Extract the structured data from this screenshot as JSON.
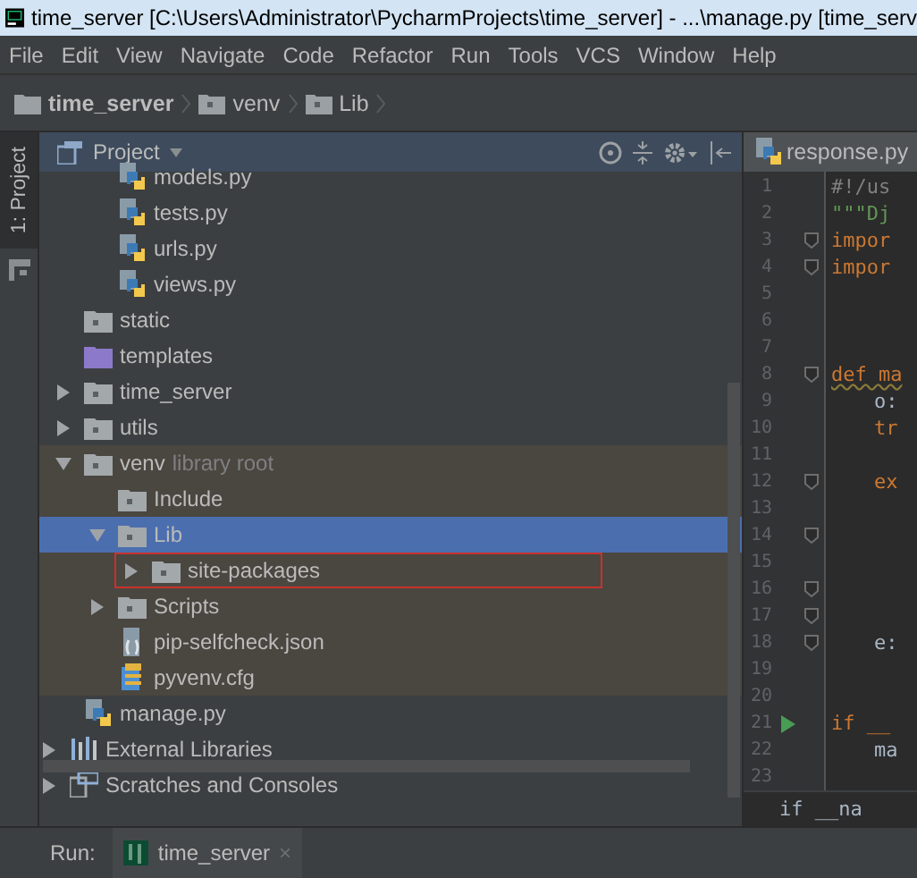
{
  "window": {
    "title": "time_server [C:\\Users\\Administrator\\PycharmProjects\\time_server] - ...\\manage.py [time_serv"
  },
  "menu": [
    "File",
    "Edit",
    "View",
    "Navigate",
    "Code",
    "Refactor",
    "Run",
    "Tools",
    "VCS",
    "Window",
    "Help"
  ],
  "breadcrumbs": [
    "time_server",
    "venv",
    "Lib"
  ],
  "tool_stripe": {
    "label": "1: Project"
  },
  "project_panel": {
    "title": "Project",
    "tree": [
      {
        "children": [
          {
            "children": [
              {
                "label": "models.py",
                "kind": "python",
                "selected": false,
                "marked": false
              },
              {
                "label": "tests.py",
                "kind": "python",
                "selected": false,
                "marked": false
              },
              {
                "label": "urls.py",
                "kind": "python",
                "selected": false,
                "marked": false
              },
              {
                "label": "views.py",
                "kind": "python",
                "selected": false,
                "marked": false
              }
            ]
          },
          {
            "label": "static",
            "kind": "folder",
            "selected": false,
            "marked": false
          },
          {
            "label": "templates",
            "kind": "template_folder",
            "selected": false,
            "marked": false
          },
          {
            "label": "time_server",
            "kind": "folder",
            "expanded": false,
            "selected": false,
            "marked": false
          },
          {
            "label": "utils",
            "kind": "folder",
            "expanded": false,
            "selected": false,
            "marked": false
          },
          {
            "label": "venv",
            "note": "library root",
            "library_root": true,
            "kind": "folder",
            "expanded": true,
            "selected": false,
            "marked": false,
            "children": [
              {
                "label": "Include",
                "kind": "folder",
                "selected": false,
                "marked": false
              },
              {
                "label": "Lib",
                "kind": "folder",
                "expanded": true,
                "selected": true,
                "marked": false,
                "children": [
                  {
                    "label": "site-packages",
                    "kind": "folder",
                    "expanded": false,
                    "selected": false,
                    "marked": true
                  }
                ]
              },
              {
                "label": "Scripts",
                "kind": "folder",
                "expanded": false,
                "selected": false,
                "marked": false
              },
              {
                "label": "pip-selfcheck.json",
                "kind": "json",
                "selected": false,
                "marked": false
              },
              {
                "label": "pyvenv.cfg",
                "kind": "config",
                "selected": false,
                "marked": false
              }
            ]
          },
          {
            "label": "manage.py",
            "kind": "python",
            "selected": false,
            "marked": false
          }
        ]
      },
      {
        "label": "External Libraries",
        "kind": "library",
        "expanded": false,
        "selected": false,
        "marked": false
      },
      {
        "label": "Scratches and Consoles",
        "kind": "scratches",
        "expanded": false,
        "selected": false,
        "marked": false
      }
    ]
  },
  "editor": {
    "tab": "response.py",
    "lines": [
      {
        "number": "1",
        "code": "#!/us",
        "kind": "comment"
      },
      {
        "number": "2",
        "code": "\"\"\"Dj",
        "kind": "docstring"
      },
      {
        "number": "3",
        "code": "impor",
        "kind": "keyword",
        "fold": true
      },
      {
        "number": "4",
        "code": "impor",
        "kind": "keyword",
        "fold": true
      },
      {
        "number": "5"
      },
      {
        "number": "6"
      },
      {
        "number": "7"
      },
      {
        "number": "8",
        "code": "def ma",
        "kind": "def",
        "fold": true
      },
      {
        "number": "9",
        "code": "o:",
        "kind": "plain",
        "indent": true
      },
      {
        "number": "10",
        "code": "tr",
        "kind": "keyword",
        "indent": true
      },
      {
        "number": "11"
      },
      {
        "number": "12",
        "code": "ex",
        "kind": "keyword",
        "indent": true,
        "fold": true
      },
      {
        "number": "13"
      },
      {
        "number": "14",
        "fold": true
      },
      {
        "number": "15"
      },
      {
        "number": "16",
        "fold": true
      },
      {
        "number": "17",
        "fold": true
      },
      {
        "number": "18",
        "code": "e:",
        "kind": "plain",
        "indent": true,
        "fold": true
      },
      {
        "number": "19"
      },
      {
        "number": "20"
      },
      {
        "number": "21",
        "code": "if __",
        "kind": "keyword",
        "run": true
      },
      {
        "number": "22",
        "code": "ma",
        "kind": "plain",
        "indent": true
      },
      {
        "number": "23"
      }
    ],
    "breadcrumb": "if __na"
  },
  "run_bar": {
    "label": "Run:",
    "tab": "time_server",
    "close": "×"
  }
}
